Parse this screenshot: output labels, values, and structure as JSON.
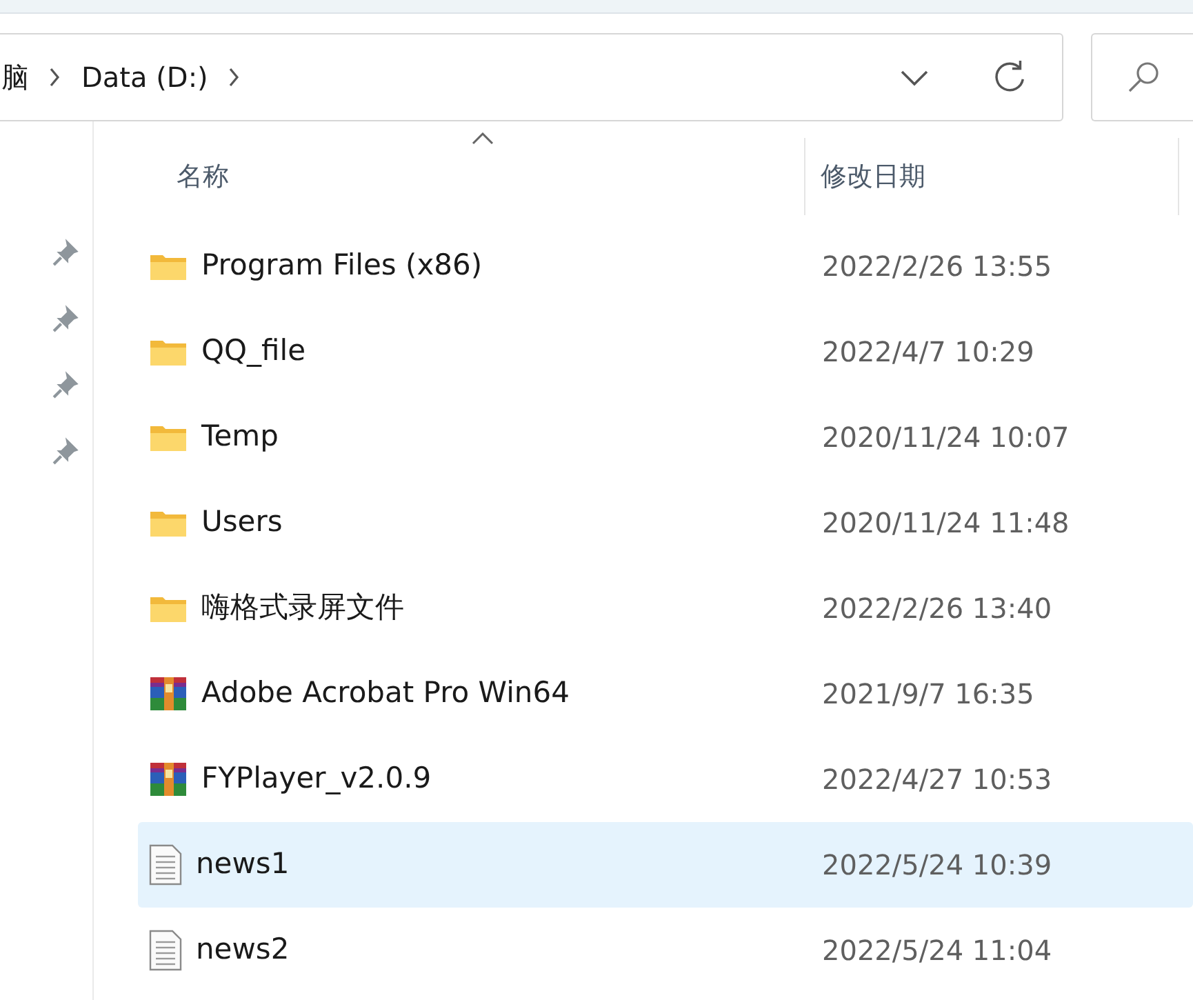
{
  "address_bar": {
    "breadcrumbs": [
      "脑",
      "Data (D:)"
    ]
  },
  "columns": [
    {
      "label": "名称",
      "sorted": true
    },
    {
      "label": "修改日期",
      "sorted": false
    }
  ],
  "quick_access_pins": [
    {
      "pinned": true
    },
    {
      "pinned": true
    },
    {
      "pinned": true
    },
    {
      "pinned": true
    }
  ],
  "files": [
    {
      "kind": "folder",
      "name": "Program Files (x86)",
      "modified": "2022/2/26 13:55",
      "selected": false
    },
    {
      "kind": "folder",
      "name": "QQ_file",
      "modified": "2022/4/7 10:29",
      "selected": false
    },
    {
      "kind": "folder",
      "name": "Temp",
      "modified": "2020/11/24 10:07",
      "selected": false
    },
    {
      "kind": "folder",
      "name": "Users",
      "modified": "2020/11/24 11:48",
      "selected": false
    },
    {
      "kind": "folder",
      "name": "嗨格式录屏文件",
      "modified": "2022/2/26 13:40",
      "selected": false
    },
    {
      "kind": "archive",
      "name": "Adobe Acrobat Pro Win64",
      "modified": "2021/9/7 16:35",
      "selected": false
    },
    {
      "kind": "archive",
      "name": "FYPlayer_v2.0.9",
      "modified": "2022/4/27 10:53",
      "selected": false
    },
    {
      "kind": "text",
      "name": "news1",
      "modified": "2022/5/24 10:39",
      "selected": true
    },
    {
      "kind": "text",
      "name": "news2",
      "modified": "2022/5/24 11:04",
      "selected": false
    }
  ]
}
